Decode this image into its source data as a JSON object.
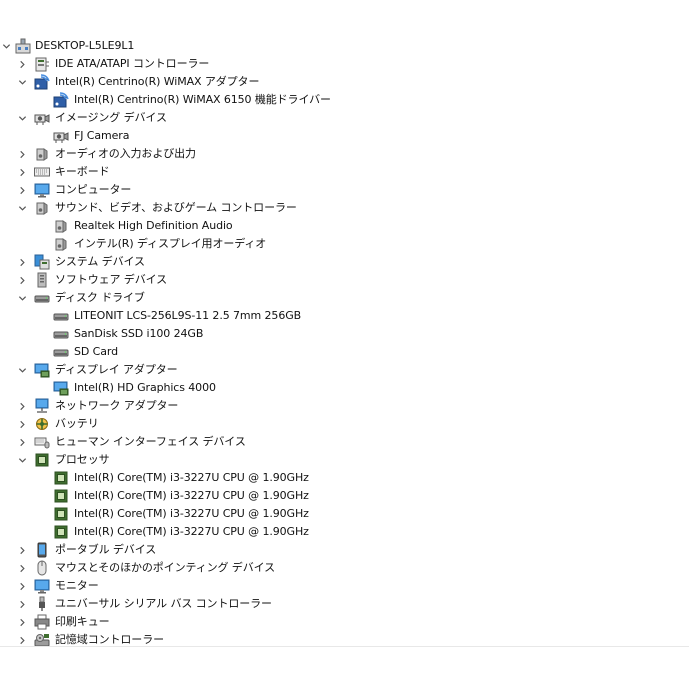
{
  "colors": {
    "background": "#ffffff",
    "text": "#111111",
    "chevron": "#555555",
    "monitor_blue": "#3a8fd8",
    "chip_green": "#3f6e2f"
  },
  "tree": {
    "root": {
      "label": "DESKTOP-L5LE9L1",
      "icon": "computer-root-icon",
      "expanded": true
    },
    "items": [
      {
        "label": "IDE ATA/ATAPI コントローラー",
        "icon": "ide-controller-icon",
        "level": 1,
        "expanded": false
      },
      {
        "label": "Intel(R) Centrino(R) WiMAX アダプター",
        "icon": "wimax-icon",
        "level": 1,
        "expanded": true
      },
      {
        "label": "Intel(R) Centrino(R) WiMAX 6150 機能ドライバー",
        "icon": "wimax-icon",
        "level": 2
      },
      {
        "label": "イメージング デバイス",
        "icon": "camera-icon",
        "level": 1,
        "expanded": true
      },
      {
        "label": "FJ Camera",
        "icon": "camera-icon",
        "level": 2
      },
      {
        "label": "オーディオの入力および出力",
        "icon": "speaker-icon",
        "level": 1,
        "expanded": false
      },
      {
        "label": "キーボード",
        "icon": "keyboard-icon",
        "level": 1,
        "expanded": false
      },
      {
        "label": "コンピューター",
        "icon": "monitor-icon",
        "level": 1,
        "expanded": false
      },
      {
        "label": "サウンド、ビデオ、およびゲーム コントローラー",
        "icon": "speaker-icon",
        "level": 1,
        "expanded": true
      },
      {
        "label": "Realtek High Definition Audio",
        "icon": "speaker-icon",
        "level": 2
      },
      {
        "label": "インテル(R) ディスプレイ用オーディオ",
        "icon": "speaker-icon",
        "level": 2
      },
      {
        "label": "システム デバイス",
        "icon": "system-device-icon",
        "level": 1,
        "expanded": false
      },
      {
        "label": "ソフトウェア デバイス",
        "icon": "software-device-icon",
        "level": 1,
        "expanded": false
      },
      {
        "label": "ディスク ドライブ",
        "icon": "disk-drive-icon",
        "level": 1,
        "expanded": true
      },
      {
        "label": "LITEONIT LCS-256L9S-11 2.5 7mm 256GB",
        "icon": "disk-drive-icon",
        "level": 2
      },
      {
        "label": "SanDisk SSD i100 24GB",
        "icon": "disk-drive-icon",
        "level": 2
      },
      {
        "label": "SD Card",
        "icon": "disk-drive-icon",
        "level": 2
      },
      {
        "label": "ディスプレイ アダプター",
        "icon": "display-adapter-icon",
        "level": 1,
        "expanded": true
      },
      {
        "label": "Intel(R) HD Graphics 4000",
        "icon": "display-adapter-icon",
        "level": 2
      },
      {
        "label": "ネットワーク アダプター",
        "icon": "network-adapter-icon",
        "level": 1,
        "expanded": false
      },
      {
        "label": "バッテリ",
        "icon": "battery-icon",
        "level": 1,
        "expanded": false
      },
      {
        "label": "ヒューマン インターフェイス デバイス",
        "icon": "hid-icon",
        "level": 1,
        "expanded": false
      },
      {
        "label": "プロセッサ",
        "icon": "processor-icon",
        "level": 1,
        "expanded": true
      },
      {
        "label": "Intel(R) Core(TM) i3-3227U CPU @ 1.90GHz",
        "icon": "processor-icon",
        "level": 2
      },
      {
        "label": "Intel(R) Core(TM) i3-3227U CPU @ 1.90GHz",
        "icon": "processor-icon",
        "level": 2
      },
      {
        "label": "Intel(R) Core(TM) i3-3227U CPU @ 1.90GHz",
        "icon": "processor-icon",
        "level": 2
      },
      {
        "label": "Intel(R) Core(TM) i3-3227U CPU @ 1.90GHz",
        "icon": "processor-icon",
        "level": 2
      },
      {
        "label": "ポータブル デバイス",
        "icon": "portable-device-icon",
        "level": 1,
        "expanded": false
      },
      {
        "label": "マウスとそのほかのポインティング デバイス",
        "icon": "mouse-icon",
        "level": 1,
        "expanded": false
      },
      {
        "label": "モニター",
        "icon": "monitor-icon",
        "level": 1,
        "expanded": false
      },
      {
        "label": "ユニバーサル シリアル バス コントローラー",
        "icon": "usb-icon",
        "level": 1,
        "expanded": false
      },
      {
        "label": "印刷キュー",
        "icon": "printer-icon",
        "level": 1,
        "expanded": false
      },
      {
        "label": "記憶域コントローラー",
        "icon": "storage-controller-icon",
        "level": 1,
        "expanded": false
      }
    ]
  }
}
